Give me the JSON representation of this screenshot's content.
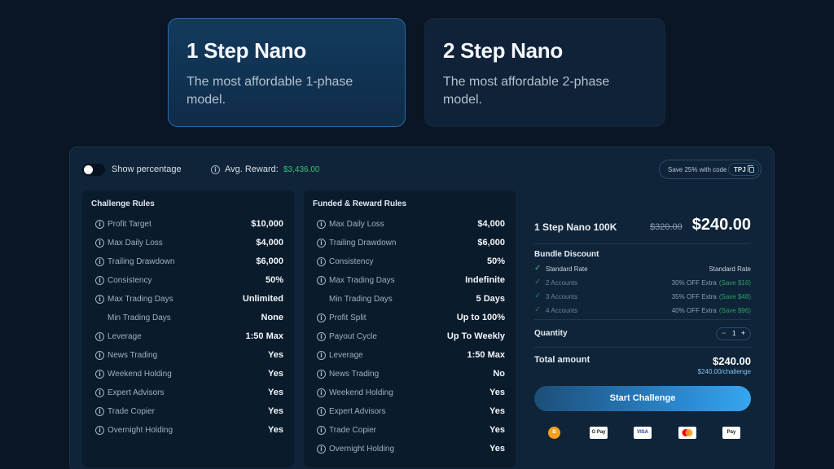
{
  "plans": [
    {
      "title": "1 Step Nano",
      "description": "The most affordable 1-phase model."
    },
    {
      "title": "2 Step Nano",
      "description": "The most affordable 2-phase model."
    }
  ],
  "toolbar": {
    "toggle_label": "Show percentage",
    "avg_label": "Avg. Reward:",
    "avg_value": "$3,436.00",
    "promo_text": "Save 25% with code",
    "promo_code": "TPJ"
  },
  "challenge_rules": {
    "title": "Challenge Rules",
    "rows": [
      {
        "label": "Profit Target",
        "value": "$10,000"
      },
      {
        "label": "Max Daily Loss",
        "value": "$4,000"
      },
      {
        "label": "Trailing Drawdown",
        "value": "$6,000"
      },
      {
        "label": "Consistency",
        "value": "50%"
      },
      {
        "label": "Max Trading Days",
        "value": "Unlimited"
      },
      {
        "label": "Min Trading Days",
        "value": "None"
      },
      {
        "label": "Leverage",
        "value": "1:50 Max"
      },
      {
        "label": "News Trading",
        "value": "Yes"
      },
      {
        "label": "Weekend Holding",
        "value": "Yes"
      },
      {
        "label": "Expert Advisors",
        "value": "Yes"
      },
      {
        "label": "Trade Copier",
        "value": "Yes"
      },
      {
        "label": "Overnight Holding",
        "value": "Yes"
      }
    ]
  },
  "funded_rules": {
    "title": "Funded & Reward Rules",
    "rows": [
      {
        "label": "Max Daily Loss",
        "value": "$4,000"
      },
      {
        "label": "Trailing Drawdown",
        "value": "$6,000"
      },
      {
        "label": "Consistency",
        "value": "50%"
      },
      {
        "label": "Max Trading Days",
        "value": "Indefinite"
      },
      {
        "label": "Min Trading Days",
        "value": "5 Days"
      },
      {
        "label": "Profit Split",
        "value": "Up to 100%"
      },
      {
        "label": "Payout Cycle",
        "value": "Up To Weekly"
      },
      {
        "label": "Leverage",
        "value": "1:50 Max"
      },
      {
        "label": "News Trading",
        "value": "No"
      },
      {
        "label": "Weekend Holding",
        "value": "Yes"
      },
      {
        "label": "Expert Advisors",
        "value": "Yes"
      },
      {
        "label": "Trade Copier",
        "value": "Yes"
      },
      {
        "label": "Overnight Holding",
        "value": "Yes"
      }
    ]
  },
  "summary": {
    "product": "1 Step Nano 100K",
    "old_price": "$320.00",
    "price": "$240.00",
    "bundle_title": "Bundle Discount",
    "bundle": [
      {
        "label": "Standard Rate",
        "value": "Standard Rate",
        "save": ""
      },
      {
        "label": "2 Accounts",
        "value": "30% OFF Extra",
        "save": "(Save $16)"
      },
      {
        "label": "3 Accounts",
        "value": "35% OFF Extra",
        "save": "(Save $48)"
      },
      {
        "label": "4 Accounts",
        "value": "40% OFF Extra",
        "save": "(Save $96)"
      }
    ],
    "quantity_label": "Quantity",
    "quantity": "1",
    "total_label": "Total amount",
    "total": "$240.00",
    "per_challenge": "$240.00/challenge",
    "cta": "Start Challenge"
  },
  "payments": [
    "B",
    "G Pay",
    "VISA",
    "mastercard",
    "Pay"
  ],
  "colors": {
    "background": "#0b1624",
    "panel": "#0f2438",
    "accent": "#2a8ad4",
    "success": "#33c27a"
  }
}
